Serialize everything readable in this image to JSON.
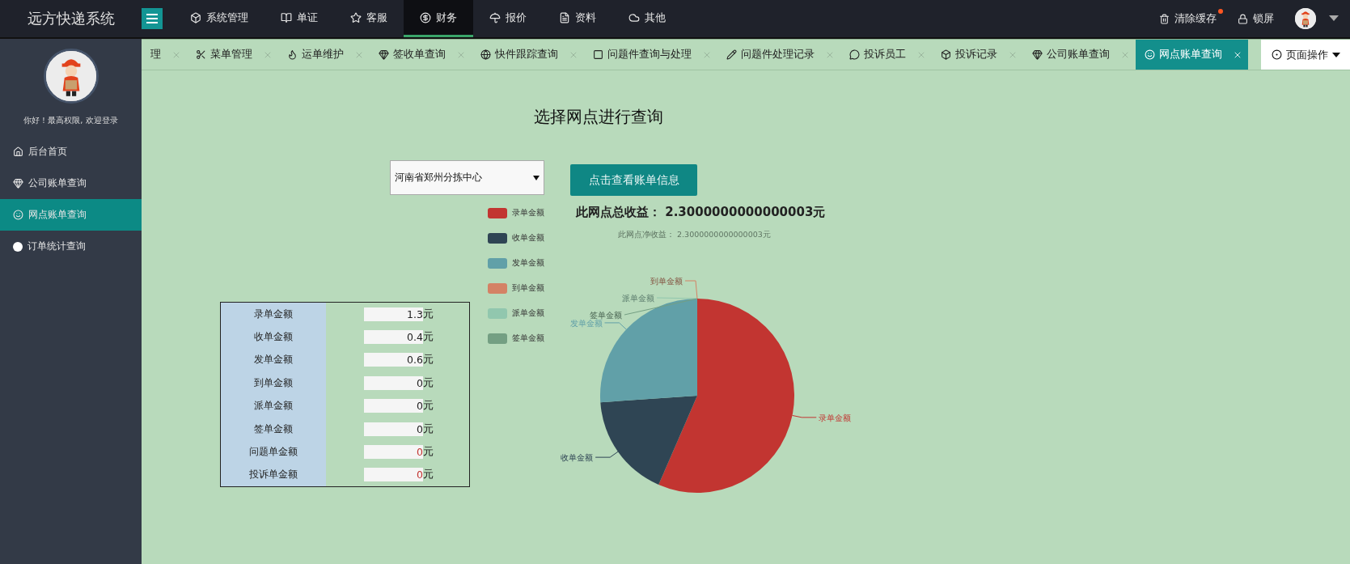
{
  "header": {
    "title": "远方快递系统",
    "nav": [
      {
        "label": "系统管理",
        "selected": false
      },
      {
        "label": "单证",
        "selected": false
      },
      {
        "label": "客服",
        "selected": false
      },
      {
        "label": "财务",
        "selected": true
      },
      {
        "label": "报价",
        "selected": false
      },
      {
        "label": "资料",
        "selected": false
      },
      {
        "label": "其他",
        "selected": false
      }
    ],
    "actions": [
      {
        "label": "清除缓存",
        "notification": true
      },
      {
        "label": "锁屏",
        "notification": false
      }
    ]
  },
  "sidebar": {
    "greeting": "你好！最高权限, 欢迎登录",
    "items": [
      {
        "label": "后台首页",
        "selected": false
      },
      {
        "label": "公司账单查询",
        "selected": false
      },
      {
        "label": "网点账单查询",
        "selected": true
      },
      {
        "label": "订单统计查询",
        "selected": false
      }
    ]
  },
  "tabs": [
    {
      "label": "理",
      "selected": false
    },
    {
      "label": "菜单管理",
      "selected": false
    },
    {
      "label": "运单维护",
      "selected": false
    },
    {
      "label": "签收单查询",
      "selected": false
    },
    {
      "label": "快件跟踪查询",
      "selected": false
    },
    {
      "label": "问题件查询与处理",
      "selected": false
    },
    {
      "label": "问题件处理记录",
      "selected": false
    },
    {
      "label": "投诉员工",
      "selected": false
    },
    {
      "label": "投诉记录",
      "selected": false
    },
    {
      "label": "公司账单查询",
      "selected": false
    },
    {
      "label": "网点账单查询",
      "selected": true
    }
  ],
  "page_actions": "页面操作",
  "title": "选择网点进行查询",
  "branch_select": {
    "value": "河南省郑州分拣中心"
  },
  "query_button": "点击查看账单信息",
  "total_income": "此网点总收益： 2.3000000000000003元",
  "net_income": "此网点净收益： 2.3000000000000003元",
  "amounts": [
    {
      "label": "录单金额",
      "value": "1.3",
      "unit": "元",
      "color": "#222222"
    },
    {
      "label": "收单金额",
      "value": "0.4",
      "unit": "元",
      "color": "#222222"
    },
    {
      "label": "发单金额",
      "value": "0.6",
      "unit": "元",
      "color": "#222222"
    },
    {
      "label": "到单金额",
      "value": "0",
      "unit": "元",
      "color": "#222222"
    },
    {
      "label": "派单金额",
      "value": "0",
      "unit": "元",
      "color": "#222222"
    },
    {
      "label": "签单金额",
      "value": "0",
      "unit": "元",
      "color": "#222222"
    },
    {
      "label": "问题单金额",
      "value": "0",
      "unit": "元",
      "color": "#c23531"
    },
    {
      "label": "投诉单金额",
      "value": "0",
      "unit": "元",
      "color": "#c23531"
    }
  ],
  "legend": [
    {
      "label": "录单金额",
      "color": "#c23531"
    },
    {
      "label": "收单金额",
      "color": "#2f4554"
    },
    {
      "label": "发单金额",
      "color": "#61a0a8"
    },
    {
      "label": "到单金额",
      "color": "#d48265"
    },
    {
      "label": "派单金额",
      "color": "#91c7ae"
    },
    {
      "label": "签单金额",
      "color": "#749f83"
    }
  ],
  "chart_data": {
    "type": "pie",
    "categories": [
      "录单金额",
      "收单金额",
      "发单金额",
      "到单金额",
      "派单金额",
      "签单金额"
    ],
    "values": [
      56.52,
      17.39,
      26.09,
      0,
      0,
      0
    ]
  }
}
